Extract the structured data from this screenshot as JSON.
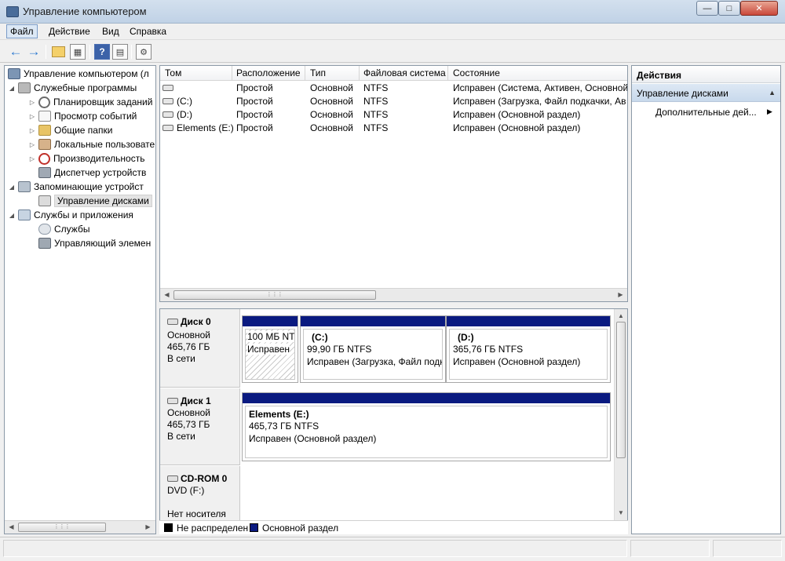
{
  "window": {
    "title": "Управление компьютером"
  },
  "menu": {
    "file": "Файл",
    "action": "Действие",
    "view": "Вид",
    "help": "Справка"
  },
  "tree": {
    "root": "Управление компьютером (л",
    "system_tools": "Служебные программы",
    "task_scheduler": "Планировщик заданий",
    "event_viewer": "Просмотр событий",
    "shared_folders": "Общие папки",
    "local_users": "Локальные пользовате",
    "performance": "Производительность",
    "device_manager": "Диспетчер устройств",
    "storage": "Запоминающие устройст",
    "disk_management": "Управление дисками",
    "services_apps": "Службы и приложения",
    "services": "Службы",
    "wmi": "Управляющий элемен"
  },
  "volume_list": {
    "columns": [
      "Том",
      "Расположение",
      "Тип",
      "Файловая система",
      "Состояние"
    ],
    "rows": [
      {
        "name": "",
        "layout": "Простой",
        "type": "Основной",
        "fs": "NTFS",
        "status": "Исправен (Система, Активен, Основной"
      },
      {
        "name": "(C:)",
        "layout": "Простой",
        "type": "Основной",
        "fs": "NTFS",
        "status": "Исправен (Загрузка, Файл подкачки, Ав"
      },
      {
        "name": "(D:)",
        "layout": "Простой",
        "type": "Основной",
        "fs": "NTFS",
        "status": "Исправен (Основной раздел)"
      },
      {
        "name": "Elements (E:)",
        "layout": "Простой",
        "type": "Основной",
        "fs": "NTFS",
        "status": "Исправен (Основной раздел)"
      }
    ]
  },
  "disks": {
    "disk0": {
      "name": "Диск 0",
      "kind": "Основной",
      "size": "465,76 ГБ",
      "state": "В сети",
      "p1": {
        "line1": "100 МБ NTF",
        "line2": "Исправен"
      },
      "p2": {
        "title": "(C:)",
        "line1": "99,90 ГБ NTFS",
        "line2": "Исправен (Загрузка, Файл подк"
      },
      "p3": {
        "title": "(D:)",
        "line1": "365,76 ГБ NTFS",
        "line2": "Исправен (Основной раздел)"
      }
    },
    "disk1": {
      "name": "Диск 1",
      "kind": "Основной",
      "size": "465,73 ГБ",
      "state": "В сети",
      "p1": {
        "title": "Elements  (E:)",
        "line1": "465,73 ГБ NTFS",
        "line2": "Исправен (Основной раздел)"
      }
    },
    "cdrom0": {
      "name": "CD-ROM 0",
      "kind": "DVD (F:)",
      "state": "Нет носителя"
    }
  },
  "legend": {
    "unallocated": "Не распределен",
    "primary": "Основной раздел",
    "unallocated_color": "#000000",
    "primary_color": "#0a1a80"
  },
  "actions": {
    "header": "Действия",
    "section": "Управление дисками",
    "more": "Дополнительные дей..."
  }
}
